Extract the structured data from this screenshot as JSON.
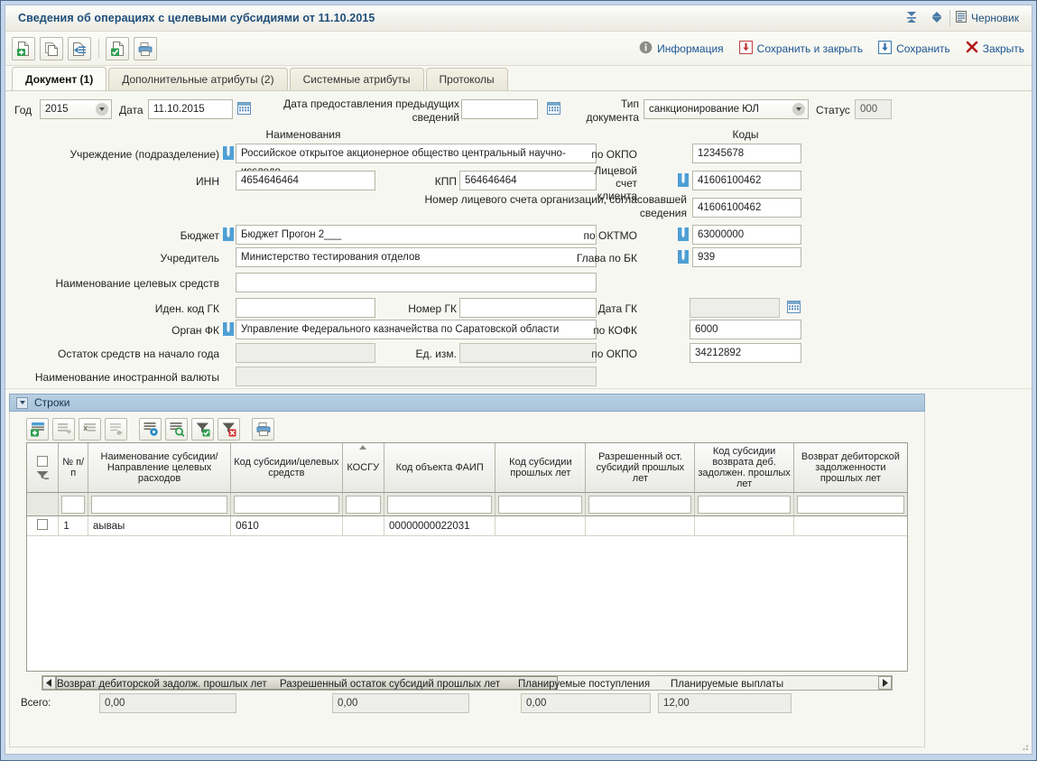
{
  "window": {
    "title": "Сведения об операциях с целевыми субсидиями от 11.10.2015",
    "draft_label": "Черновик",
    "expand_all_icon": "expand-all-icon",
    "collapse_all_icon": "collapse-all-icon"
  },
  "toolbar": {
    "buttons": [
      {
        "name": "new-document-button",
        "icon": "new-document-icon"
      },
      {
        "name": "copy-document-button",
        "icon": "copy-document-icon"
      },
      {
        "name": "import-document-button",
        "icon": "import-document-icon"
      },
      {
        "name": "validate-document-button",
        "icon": "check-document-icon"
      },
      {
        "name": "print-document-button",
        "icon": "printer-icon"
      }
    ],
    "info_label": "Информация",
    "save_and_close_label": "Сохранить и закрыть",
    "save_label": "Сохранить",
    "close_label": "Закрыть"
  },
  "tabs": [
    {
      "label": "Документ (1)",
      "active": true
    },
    {
      "label": "Дополнительные атрибуты (2)",
      "active": false
    },
    {
      "label": "Системные атрибуты",
      "active": false
    },
    {
      "label": "Протоколы",
      "active": false
    }
  ],
  "form": {
    "year_label": "Год",
    "year_value": "2015",
    "date_label": "Дата",
    "date_value": "11.10.2015",
    "prev_info_date_label": "Дата предоставления предыдущих сведений",
    "prev_info_date_value": "",
    "doc_type_label": "Тип документа",
    "doc_type_value": "санкционирование ЮЛ",
    "status_label": "Статус",
    "status_value": "000",
    "names_header": "Наименования",
    "codes_header": "Коды",
    "institution_label": "Учреждение (подразделение)",
    "institution_value": "Российское открытое акционерное общество центральный научно-исследо",
    "okpo_label": "по ОКПО",
    "okpo_value": "12345678",
    "inn_label": "ИНН",
    "inn_value": "4654646464",
    "kpp_label": "КПП",
    "kpp_value": "564646464",
    "client_account_label": "Лицевой счет клиента",
    "client_account_value": "41606100462",
    "org_account_label": "Номер лицевого счета организации, согласовавшей сведения",
    "org_account_value": "41606100462",
    "budget_label": "Бюджет",
    "budget_value": "Бюджет Прогон 2___",
    "oktmo_label": "по ОКТМО",
    "oktmo_value": "63000000",
    "founder_label": "Учредитель",
    "founder_value": "Министерство тестирования отделов",
    "glava_bk_label": "Глава по БК",
    "glava_bk_value": "939",
    "target_funds_label": "Наименование целевых средств",
    "target_funds_value": "",
    "gk_code_label": "Иден. код ГК",
    "gk_code_value": "",
    "gk_number_label": "Номер ГК",
    "gk_number_value": "",
    "gk_date_label": "Дата ГК",
    "gk_date_value": "",
    "organ_fk_label": "Орган ФК",
    "organ_fk_value": "Управление Федерального казначейства по Саратовской области",
    "kofk_label": "по КОФК",
    "kofk_value": "6000",
    "okpo2_label": "по ОКПО",
    "okpo2_value": "34212892",
    "balance_label": "Остаток средств на начало года",
    "balance_value": "",
    "unit_label": "Ед. изм.",
    "unit_value": "",
    "currency_label": "Наименование иностранной валюты",
    "currency_value": ""
  },
  "rows_panel": {
    "header": "Строки",
    "toolbar": [
      {
        "name": "grid-add-row-button",
        "icon": "add-row-icon"
      },
      {
        "name": "grid-insert-row-button",
        "icon": "insert-row-icon"
      },
      {
        "name": "grid-delete-row-button",
        "icon": "delete-row-icon"
      },
      {
        "name": "grid-edit-row-button",
        "icon": "edit-row-icon"
      },
      {
        "name": "grid-settings-button",
        "icon": "grid-settings-icon"
      },
      {
        "name": "grid-search-button",
        "icon": "grid-search-icon"
      },
      {
        "name": "grid-apply-filter-button",
        "icon": "filter-apply-icon"
      },
      {
        "name": "grid-clear-filter-button",
        "icon": "filter-clear-icon"
      },
      {
        "name": "grid-print-button",
        "icon": "printer-icon"
      }
    ],
    "columns": [
      {
        "label": "№ п/п",
        "sorted": false
      },
      {
        "label": "Наименование субсидии/Направление целевых расходов",
        "sorted": false
      },
      {
        "label": "Код субсидии/целевых средств",
        "sorted": false
      },
      {
        "label": "КОСГУ",
        "sorted": true
      },
      {
        "label": "Код объекта ФАИП",
        "sorted": false
      },
      {
        "label": "Код субсидии прошлых лет",
        "sorted": false
      },
      {
        "label": "Разрешенный ост. субсидий прошлых лет",
        "sorted": false
      },
      {
        "label": "Код субсидии возврата деб. задолжен. прошлых лет",
        "sorted": false
      },
      {
        "label": "Возврат дебиторской задолженности прошлых лет",
        "sorted": false
      }
    ],
    "filter_values": [
      "",
      "",
      "",
      "",
      "",
      "",
      "",
      "",
      ""
    ],
    "rows": [
      {
        "num": "1",
        "name": "аываы",
        "subsidy_code": "0610",
        "kosgu": "",
        "faip_code": "00000000022031",
        "prev_subsidy_code": "",
        "allowed_balance": "",
        "return_subsidy_code": "",
        "return_receivables": ""
      }
    ]
  },
  "totals": {
    "all_label": "Всего:",
    "items": [
      {
        "label": "Возврат дебиторской задолж. прошлых лет",
        "value": "0,00"
      },
      {
        "label": "Разрешенный остаток субсидий прошлых лет",
        "value": "0,00"
      },
      {
        "label": "Планируемые поступления",
        "value": "0,00"
      },
      {
        "label": "Планируемые выплаты",
        "value": "12,00"
      }
    ]
  },
  "colors": {
    "title": "#1f4e79",
    "link": "#1a5490",
    "panel_header": "#a9c4da",
    "window_frame": "#c3d5e8",
    "close_x": "#b31b1b",
    "green": "#2e9e4f"
  }
}
